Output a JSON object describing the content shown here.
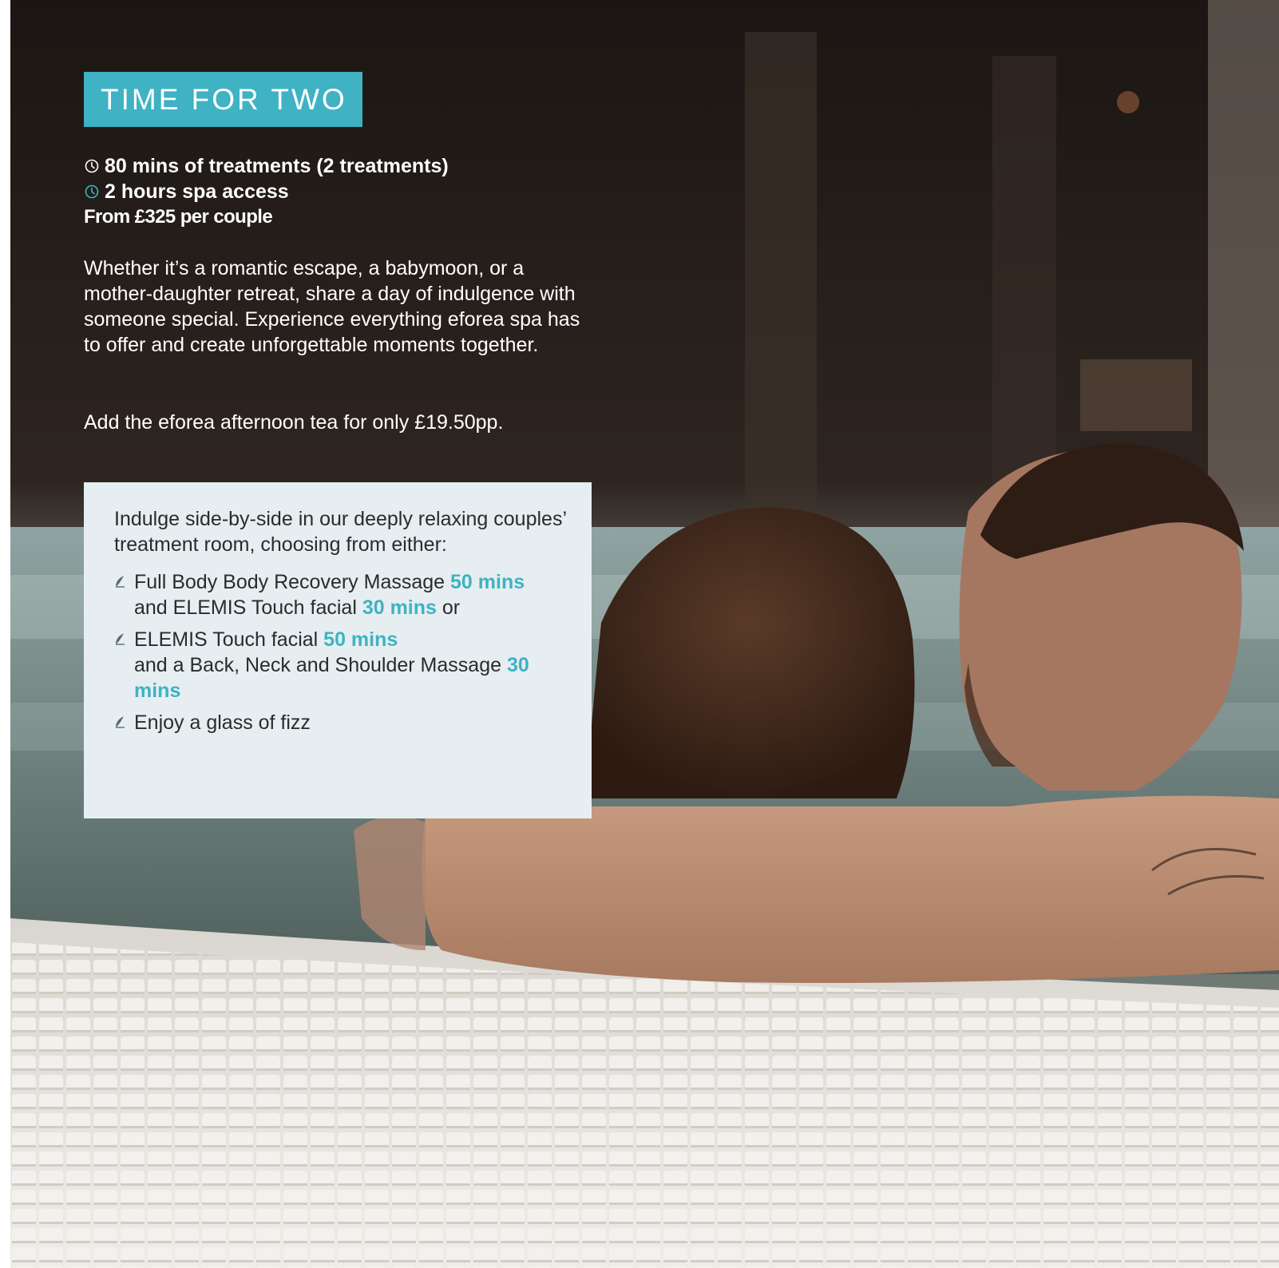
{
  "colors": {
    "accent": "#3fb2c4",
    "panel_bg": "#e6eef1",
    "text_light": "#ffffff",
    "text_dark": "#2b2b2b"
  },
  "heading": "TIME FOR TWO",
  "facts": [
    {
      "icon": "clock-icon",
      "text": "80 mins of treatments (2 treatments)"
    },
    {
      "icon": "clock-icon",
      "text": "2 hours spa access"
    }
  ],
  "price": "From £325 per couple",
  "description": "Whether it’s a romantic escape, a babymoon, or a mother-daughter retreat, share a day of indulgence with someone special. Experience everything eforea spa has to offer and create unforgettable moments together.",
  "addon": "Add the eforea afternoon tea for only £19.50pp.",
  "panel": {
    "intro": "Indulge side-by-side in our deeply relaxing couples’ treatment room, choosing from either:",
    "options": [
      {
        "icon": "leaf-icon",
        "name": "Full Body Body Recovery Massage",
        "duration": "50 mins",
        "second_prefix": "and ELEMIS Touch facial",
        "second_duration": "30 mins",
        "suffix": "or"
      },
      {
        "icon": "leaf-icon",
        "name": "ELEMIS Touch facial",
        "duration": "50 mins",
        "second_prefix": "and a Back, Neck and Shoulder Massage",
        "second_duration": "30 mins"
      },
      {
        "icon": "leaf-icon",
        "name": "Enjoy a glass of fizz"
      }
    ]
  }
}
